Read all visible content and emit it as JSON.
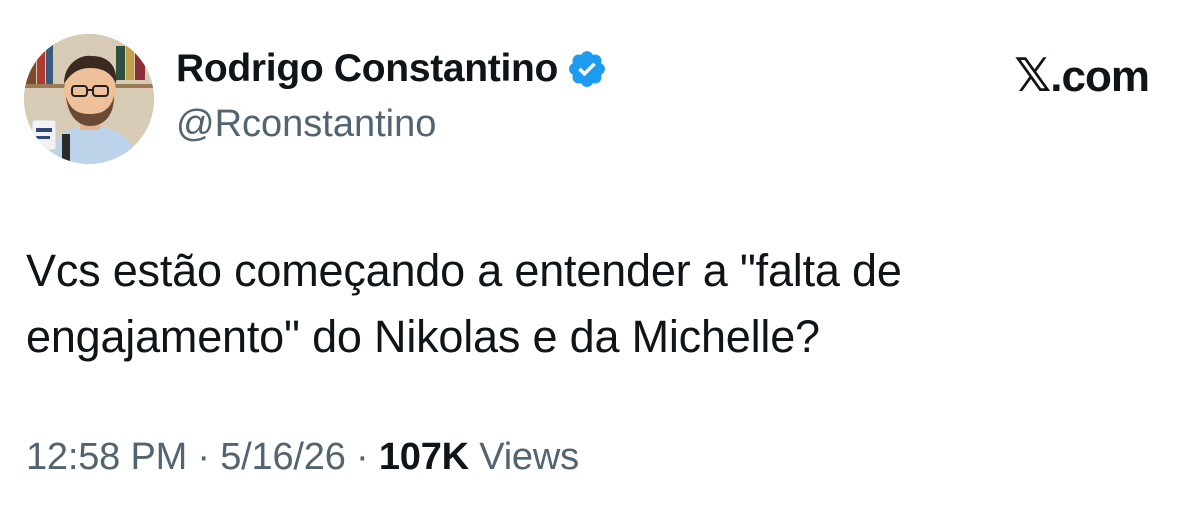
{
  "author": {
    "display_name": "Rodrigo Constantino",
    "handle": "@Rconstantino",
    "verified": true,
    "verified_badge_color": "#1d9bf0",
    "avatar_icon": "profile-photo"
  },
  "brand": {
    "label": ".com",
    "icon": "x-logo-icon"
  },
  "tweet": {
    "text_line1": "Vcs estão começando a entender a \"falta de",
    "text_line2": "engajamento\" do Nikolas e da Michelle?"
  },
  "meta": {
    "time": "12:58 PM",
    "separator": "·",
    "date": "5/16/26",
    "views_count": "107K",
    "views_label": "Views"
  },
  "colors": {
    "text_primary": "#0f1419",
    "text_secondary": "#536471",
    "background": "#ffffff"
  }
}
